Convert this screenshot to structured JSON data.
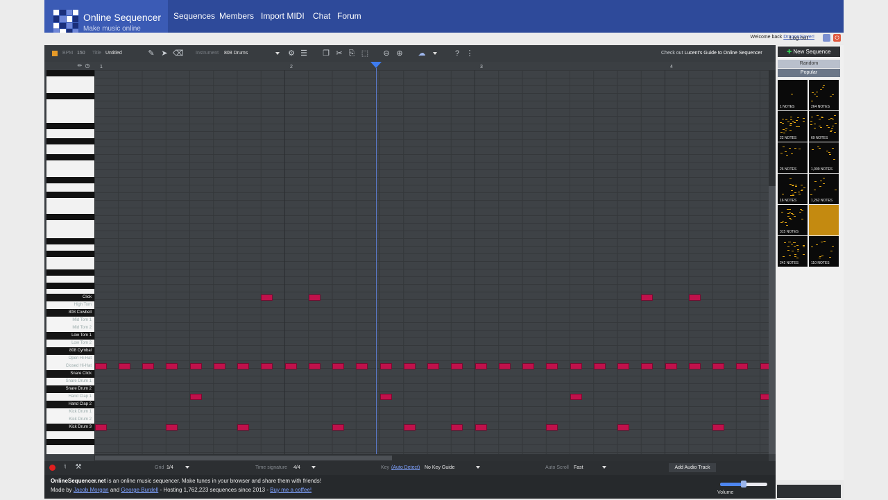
{
  "site": {
    "title": "Online Sequencer",
    "subtitle": "Make music online"
  },
  "nav": [
    {
      "label": "Sequences"
    },
    {
      "label": "Members"
    },
    {
      "label": "Import MIDI"
    },
    {
      "label": "Chat"
    },
    {
      "label": "Forum"
    }
  ],
  "account": {
    "welcome_prefix": "Welcome back ",
    "username": "DragonSlayer!",
    "logout": "Log out"
  },
  "toolbar": {
    "bpm_label": "BPM",
    "bpm_value": "150",
    "title_label": "Title",
    "title_value": "Untitled",
    "instrument_label": "Instrument",
    "instrument_value": "808 Drums",
    "checkout_prefix": "Check out ",
    "checkout_link": "Lucent's Guide to Online Sequencer"
  },
  "ruler": {
    "bars": [
      "1",
      "2",
      "3",
      "4"
    ]
  },
  "drum_rows": [
    {
      "label": "Click",
      "dark": true
    },
    {
      "label": "High Tom",
      "dark": false
    },
    {
      "label": "808 Cowbell",
      "dark": true
    },
    {
      "label": "Mid Tom 1",
      "dark": false
    },
    {
      "label": "Mid Tom 2",
      "dark": false
    },
    {
      "label": "Low Tom 1",
      "dark": true
    },
    {
      "label": "Low Tom 2",
      "dark": false
    },
    {
      "label": "808 Cymbal",
      "dark": true
    },
    {
      "label": "Open Hi-Hat",
      "dark": false
    },
    {
      "label": "Closed Hi-Hat",
      "dark": false
    },
    {
      "label": "Snare Click",
      "dark": true
    },
    {
      "label": "Snare Drum 1",
      "dark": false
    },
    {
      "label": "Snare Drum 2",
      "dark": true
    },
    {
      "label": "Hand Clap 1",
      "dark": false
    },
    {
      "label": "Hand Clap 2",
      "dark": true
    },
    {
      "label": "Kick Drum 1",
      "dark": false
    },
    {
      "label": "Kick Drum 2",
      "dark": false
    },
    {
      "label": "Kick Drum 3",
      "dark": true
    }
  ],
  "notes": {
    "Click": [
      7,
      9,
      23,
      25
    ],
    "Closed Hi-Hat": [
      0,
      1,
      2,
      3,
      4,
      5,
      6,
      7,
      8,
      9,
      10,
      11,
      12,
      13,
      14,
      15,
      16,
      17,
      18,
      19,
      20,
      21,
      22,
      23,
      24,
      25,
      26,
      27,
      28
    ],
    "Hand Clap 1": [
      4,
      12,
      20,
      28
    ],
    "Kick Drum 3": [
      0,
      3,
      6,
      10,
      13,
      15,
      16,
      19,
      22,
      26
    ]
  },
  "bottom": {
    "grid_label": "Grid",
    "grid_value": "1/4",
    "timesig_label": "Time signature",
    "timesig_value": "4/4",
    "key_label": "Key",
    "key_detect": "(Auto Detect)",
    "key_value": "No Key Guide",
    "autoscroll_label": "Auto Scroll",
    "autoscroll_value": "Fast",
    "add_audio": "Add Audio Track"
  },
  "footer": {
    "brand": "OnlineSequencer.net",
    "tagline": " is an online music sequencer. Make tunes in your browser and share them with friends!",
    "made_by": "Made by ",
    "author1": "Jacob Morgan",
    "and": " and ",
    "author2": "George Burdell",
    "hosting": " - Hosting 1,762,223 sequences since 2013 - ",
    "coffee": "Buy me a coffee!"
  },
  "volume": {
    "label": "Volume",
    "level": 0.5
  },
  "sidebar": {
    "new_sequence": "New Sequence",
    "tabs": [
      "Random",
      "Popular"
    ],
    "thumbs": [
      {
        "caption": "1 NOTES"
      },
      {
        "caption": "264 NOTES"
      },
      {
        "caption": "22 NOTES"
      },
      {
        "caption": "69 NOTES"
      },
      {
        "caption": "26 NOTES"
      },
      {
        "caption": "1,009 NOTES"
      },
      {
        "caption": "16 NOTES"
      },
      {
        "caption": "1,262 NOTES"
      },
      {
        "caption": "315 NOTES"
      },
      {
        "caption": ""
      },
      {
        "caption": "242 NOTES"
      },
      {
        "caption": "110 NOTES"
      }
    ]
  },
  "colors": {
    "note": "#c0114b",
    "topbar": "#2e4a9a",
    "accent": "#3e7cf0"
  }
}
